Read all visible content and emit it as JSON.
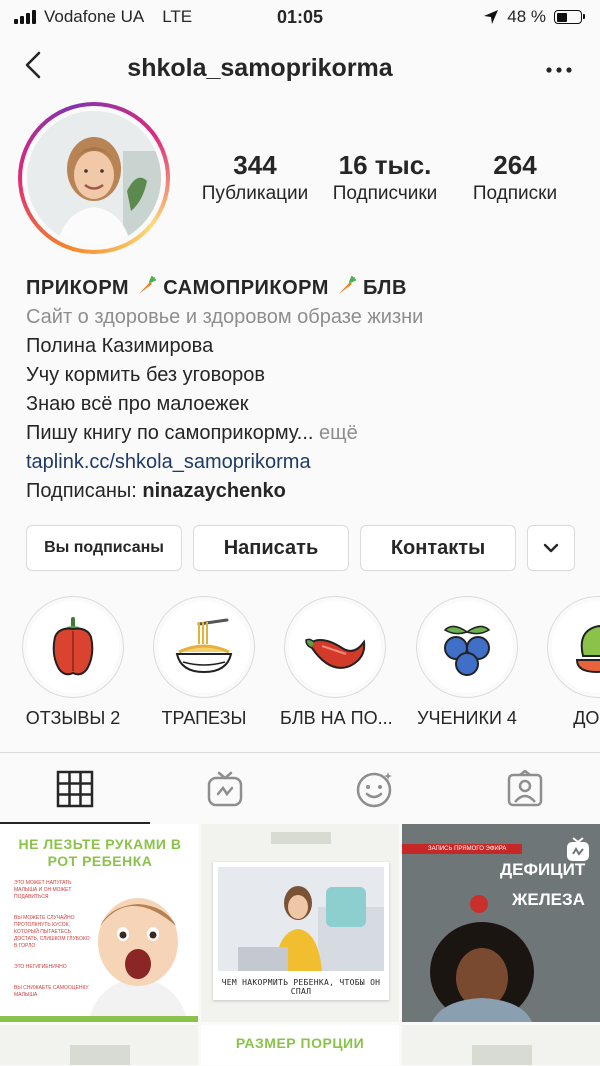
{
  "status_bar": {
    "carrier": "Vodafone UA",
    "network": "LTE",
    "time": "01:05",
    "battery": "48 %"
  },
  "nav": {
    "username": "shkola_samoprikorma"
  },
  "stats": [
    {
      "value": "344",
      "label": "Публикации"
    },
    {
      "value": "16 тыс.",
      "label": "Подписчики"
    },
    {
      "value": "264",
      "label": "Подписки"
    }
  ],
  "bio": {
    "title_part1": "ПРИКОРМ",
    "title_part2": "САМОПРИКОРМ",
    "title_part3": "БЛВ",
    "category": "Сайт о здоровье и здоровом образе жизни",
    "lines": [
      "Полина Казимирова",
      "Учу кормить без уговоров",
      "Знаю всё про малоежек",
      "Пишу книгу по самоприкорму..."
    ],
    "more": "ещё",
    "link": "taplink.cc/shkola_samoprikorma",
    "followed_by_label": "Подписаны:",
    "followed_by_user": "ninazaychenko"
  },
  "actions": {
    "following": "Вы подписаны",
    "message": "Написать",
    "contacts": "Контакты"
  },
  "highlights": [
    {
      "label": "ОТЗЫВЫ 2",
      "icon": "bell-pepper-icon"
    },
    {
      "label": "ТРАПЕЗЫ",
      "icon": "spaghetti-icon"
    },
    {
      "label": "БЛВ НА ПО...",
      "icon": "chili-pepper-icon"
    },
    {
      "label": "УЧЕНИКИ 4",
      "icon": "blueberries-icon"
    },
    {
      "label": "ДОЧЬ",
      "icon": "vegetables-icon"
    }
  ],
  "tabs": [
    "grid-icon",
    "igtv-icon",
    "reels-icon",
    "tagged-icon"
  ],
  "posts": [
    {
      "heading": "НЕ ЛЕЗЬТЕ РУКАМИ В РОТ РЕБЕНКА",
      "side_lines": [
        "ЭТО МОЖЕТ НАПУГАТЬ МАЛЫША И ОН МОЖЕТ ПОДАВИТЬСЯ",
        "ВЫ МОЖЕТЕ СЛУЧАЙНО ПРОТОЛКНУТЬ КУСОК, КОТОРЫЙ ПЫТАЕТЕСЬ ДОСТАТЬ, СЛИШКОМ ГЛУБОКО В ГОРЛО",
        "ЭТО НЕГИГИЕНИЧНО",
        "ВЫ СНИЖАЕТЕ САМООЦЕНКУ МАЛЫША"
      ]
    },
    {
      "caption": "ЧЕМ НАКОРМИТЬ РЕБЕНКА, ЧТОБЫ ОН СПАЛ"
    },
    {
      "tag": "ЗАПИСЬ ПРЯМОГО ЭФИРА",
      "title_line1": "ДЕФИЦИТ",
      "title_line2": "ЖЕЛЕЗА"
    },
    {
      "caption": "РАЗМЕР ПОРЦИИ"
    }
  ],
  "colors": {
    "link": "#1f3a66",
    "muted": "#8e8e8e",
    "post_green": "#8bc34a"
  }
}
